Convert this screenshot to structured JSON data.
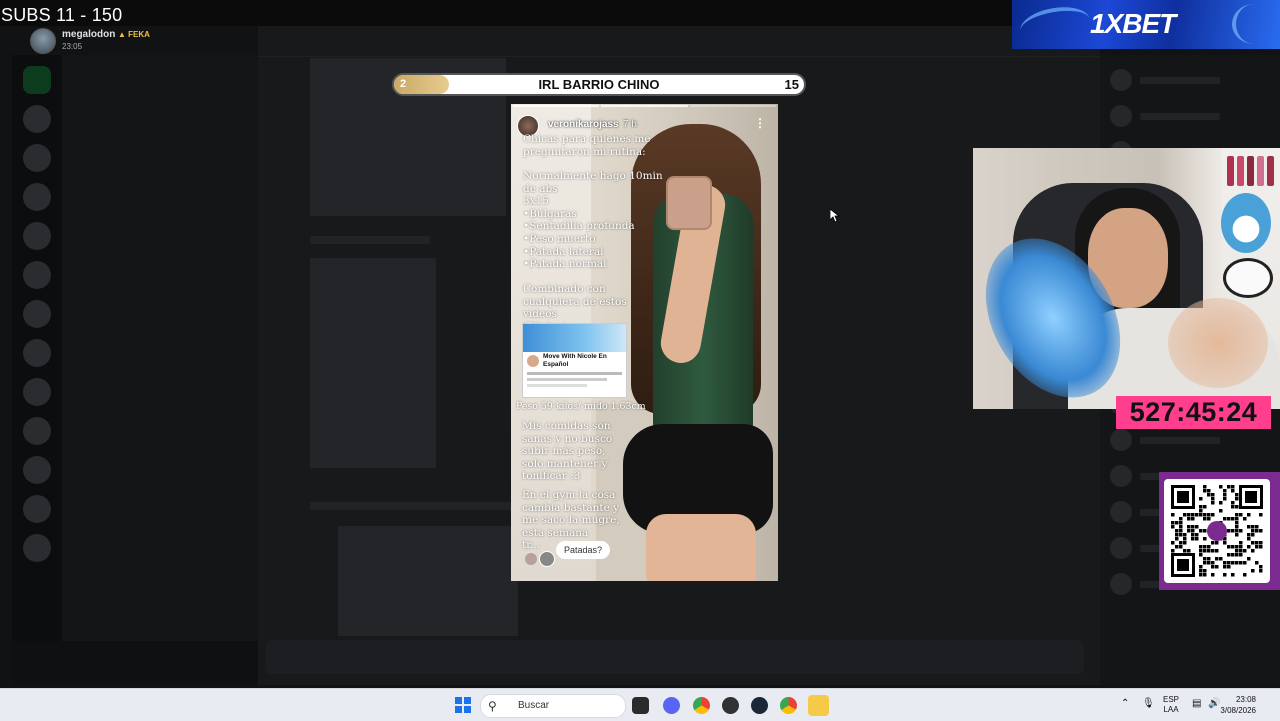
{
  "overlay": {
    "subs_label": "SUBS 11 - 150",
    "goal": {
      "current": "2",
      "title": "IRL BARRIO CHINO",
      "max": "15",
      "progress_fraction": 0.133
    },
    "timer": "527:45:24",
    "sponsor": "1XBET"
  },
  "profile": {
    "name": "megalodon",
    "tag": "FEKA",
    "time": "23:05"
  },
  "story": {
    "username": "veronikarojass",
    "time": "7 h",
    "text_intro": "Chicas para quienes me\npreguntaron mi rutina:",
    "text_routine": "Normalmente hago 10min\nde abs\n3x15\n•Búlgaras\n•Sentadilla profunda\n•Peso muerto\n•Patada lateral\n•Patada normal",
    "text_combo": "Combinado con\ncualquiera de estos videos\n(Pilates)",
    "card_title": "Move With Nicole En Español",
    "text_weight": "Peso 59 kilos/ mido 1.63cm",
    "text_food": "Mis comidas son\nsanas y no busco\nsubir más peso,\nsolo mantener y\ntonificar :3",
    "text_gym": "En el gym la cosa\ncambia bastante y\nme saco la mugre,\nesta semana\ntr...",
    "reply": "Patadas?"
  },
  "taskbar": {
    "search_placeholder": "Buscar",
    "lang_top": "ESP",
    "lang_bottom": "LAA",
    "clock_time": "23:08",
    "clock_date": "3/08/2026"
  },
  "colors": {
    "timer_bg": "#ff3e8d",
    "goal_fill": "#d8bc7a",
    "qr_frame": "#7b2a8f",
    "taskbar_bg": "#e8ecf2"
  }
}
